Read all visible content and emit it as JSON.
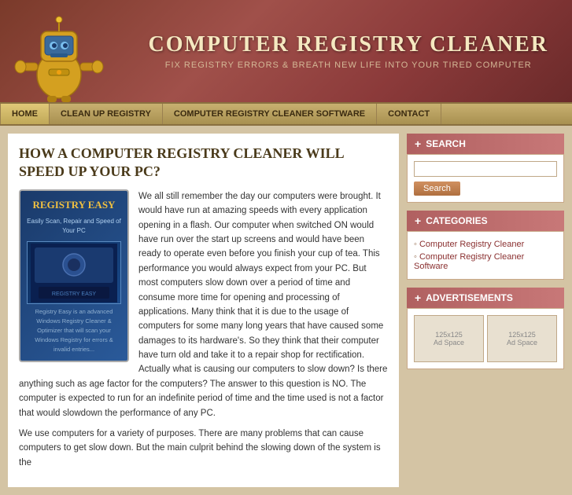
{
  "header": {
    "title": "COMPUTER REGISTRY CLEANER",
    "subtitle": "FIX REGISTRY ERRORS & BREATH NEW LIFE INTO YOUR TIRED COMPUTER"
  },
  "nav": {
    "items": [
      {
        "label": "HOME",
        "active": true
      },
      {
        "label": "CLEAN UP REGISTRY",
        "active": false
      },
      {
        "label": "COMPUTER REGISTRY CLEANER SOFTWARE",
        "active": false
      },
      {
        "label": "CONTACT",
        "active": false
      }
    ]
  },
  "article": {
    "title": "HOW A COMPUTER REGISTRY CLEANER WILL SPEED UP YOUR PC?",
    "paragraphs": [
      "We all still remember the day our computers were brought. It would have run at amazing speeds with every application opening in a flash. Our computer when switched ON would have run over the start up screens and would have been ready to operate even before you finish your cup of tea. This performance you would always expect from your PC. But most computers slow down over a period of time and consume more time for opening and processing of applications. Many think that it is due to the usage of computers for some many long years that have caused some damages to its hardware's. So they think that their computer have turn old and take it to a repair shop for rectification. Actually what is causing our computers to slow down? Is there anything such as age factor for the computers? The answer to this question is NO. The computer is expected to run for an indefinite period of time and the time used is not a factor that would slowdown the performance of any PC.",
      "We use computers for a variety of purposes. There are many problems that can cause computers to get slow down. But the main culprit behind the slowing down of the system is the"
    ],
    "box": {
      "title": "REGISTRY EASY",
      "sub": "Easily Scan, Repair and Speed of Your PC",
      "footer": "Registry Easy is an advanced Windows Registry Cleaner & Optimizer that will scan your Windows Registry for errors & invalid entries..."
    }
  },
  "sidebar": {
    "search": {
      "title": "SEARCH",
      "placeholder": "",
      "button_label": "Search"
    },
    "categories": {
      "title": "CATEGORIES",
      "items": [
        {
          "label": "Computer Registry Cleaner",
          "url": "#"
        },
        {
          "label": "Computer Registry Cleaner Software",
          "url": "#"
        }
      ]
    },
    "advertisements": {
      "title": "ADVERTISEMENTS",
      "ads": [
        {
          "label": "125x125\nAd Space"
        },
        {
          "label": "125x125\nAd Space"
        }
      ]
    }
  }
}
